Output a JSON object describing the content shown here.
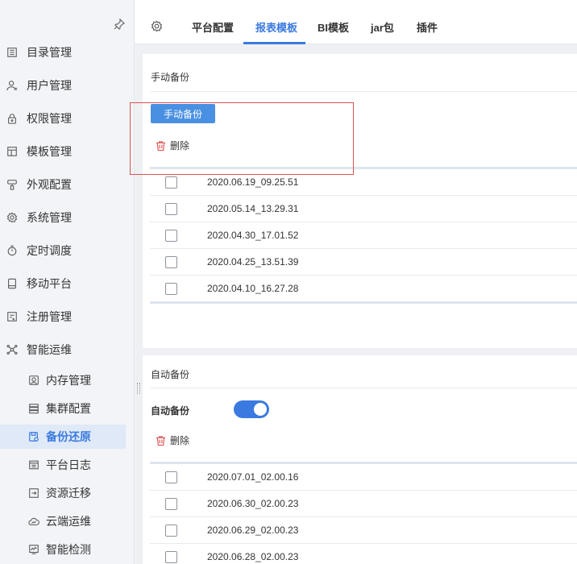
{
  "sidebar": {
    "items": [
      {
        "label": "目录管理",
        "icon": "catalog-icon"
      },
      {
        "label": "用户管理",
        "icon": "user-icon"
      },
      {
        "label": "权限管理",
        "icon": "lock-icon"
      },
      {
        "label": "模板管理",
        "icon": "template-icon"
      },
      {
        "label": "外观配置",
        "icon": "brush-icon"
      },
      {
        "label": "系统管理",
        "icon": "gear-icon"
      },
      {
        "label": "定时调度",
        "icon": "timer-icon"
      },
      {
        "label": "移动平台",
        "icon": "mobile-icon"
      },
      {
        "label": "注册管理",
        "icon": "register-icon"
      },
      {
        "label": "智能运维",
        "icon": "network-icon"
      }
    ],
    "sub_items": [
      {
        "label": "内存管理",
        "icon": "memory-icon"
      },
      {
        "label": "集群配置",
        "icon": "cluster-icon"
      },
      {
        "label": "备份还原",
        "icon": "backup-icon",
        "active": true
      },
      {
        "label": "平台日志",
        "icon": "log-icon"
      },
      {
        "label": "资源迁移",
        "icon": "migrate-icon"
      },
      {
        "label": "云端运维",
        "icon": "cloud-icon"
      },
      {
        "label": "智能检测",
        "icon": "detect-icon"
      }
    ]
  },
  "tabs": {
    "items": [
      "平台配置",
      "报表模板",
      "BI模板",
      "jar包",
      "插件"
    ],
    "active": "报表模板"
  },
  "manual": {
    "header": "手动备份",
    "button_label": "手动备份",
    "delete_label": "删除",
    "rows": [
      "2020.06.19_09.25.51",
      "2020.05.14_13.29.31",
      "2020.04.30_17.01.52",
      "2020.04.25_13.51.39",
      "2020.04.10_16.27.28"
    ]
  },
  "auto": {
    "header": "自动备份",
    "toggle_label": "自动备份",
    "toggle_on": true,
    "delete_label": "删除",
    "rows": [
      "2020.07.01_02.00.16",
      "2020.06.30_02.00.23",
      "2020.06.29_02.00.23",
      "2020.06.28_02.00.23"
    ]
  },
  "colors": {
    "accent": "#3a7ae0",
    "button": "#4a90e2",
    "highlight": "#d9534f",
    "delete_icon": "#e05050"
  }
}
